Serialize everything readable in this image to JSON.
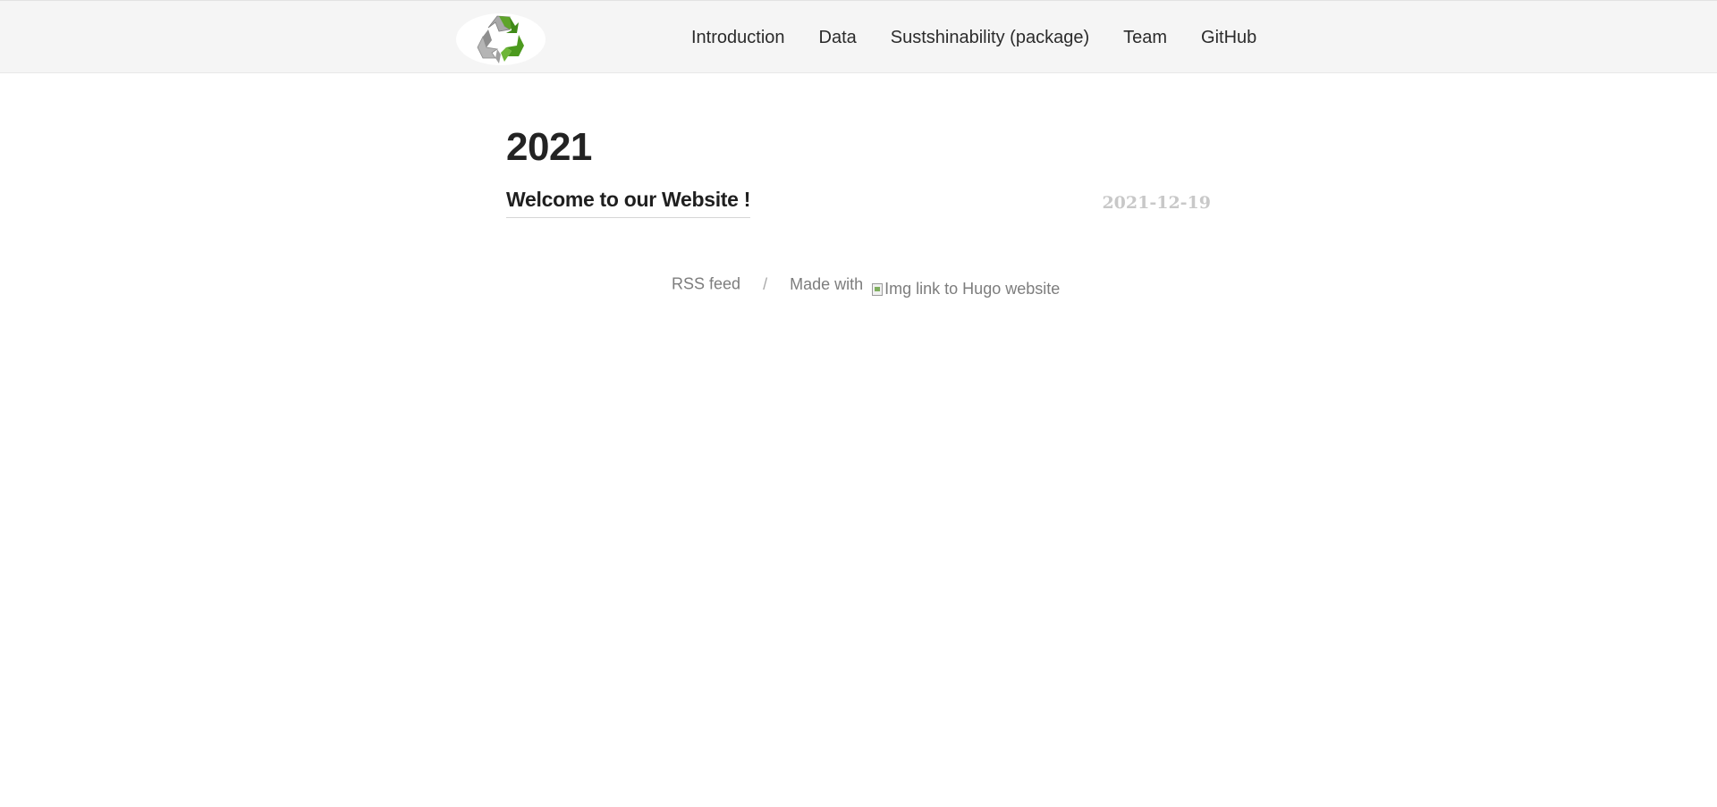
{
  "nav": {
    "items": [
      {
        "label": "Introduction"
      },
      {
        "label": "Data"
      },
      {
        "label": "Sustshinability (package)"
      },
      {
        "label": "Team"
      },
      {
        "label": "GitHub"
      }
    ]
  },
  "logo": {
    "icon": "recycle-icon"
  },
  "main": {
    "year_heading": "2021",
    "posts": [
      {
        "title": "Welcome to our Website !",
        "date": "2021-12-19"
      }
    ]
  },
  "footer": {
    "rss_label": "RSS feed",
    "separator": "/",
    "made_with": "Made with",
    "hugo_img_alt": "Img link to Hugo website"
  },
  "colors": {
    "header_bg": "#f5f5f5",
    "recycle_green": "#4f9a1d",
    "recycle_gray": "#9c9c9c",
    "date_color": "#c8c8c8"
  }
}
